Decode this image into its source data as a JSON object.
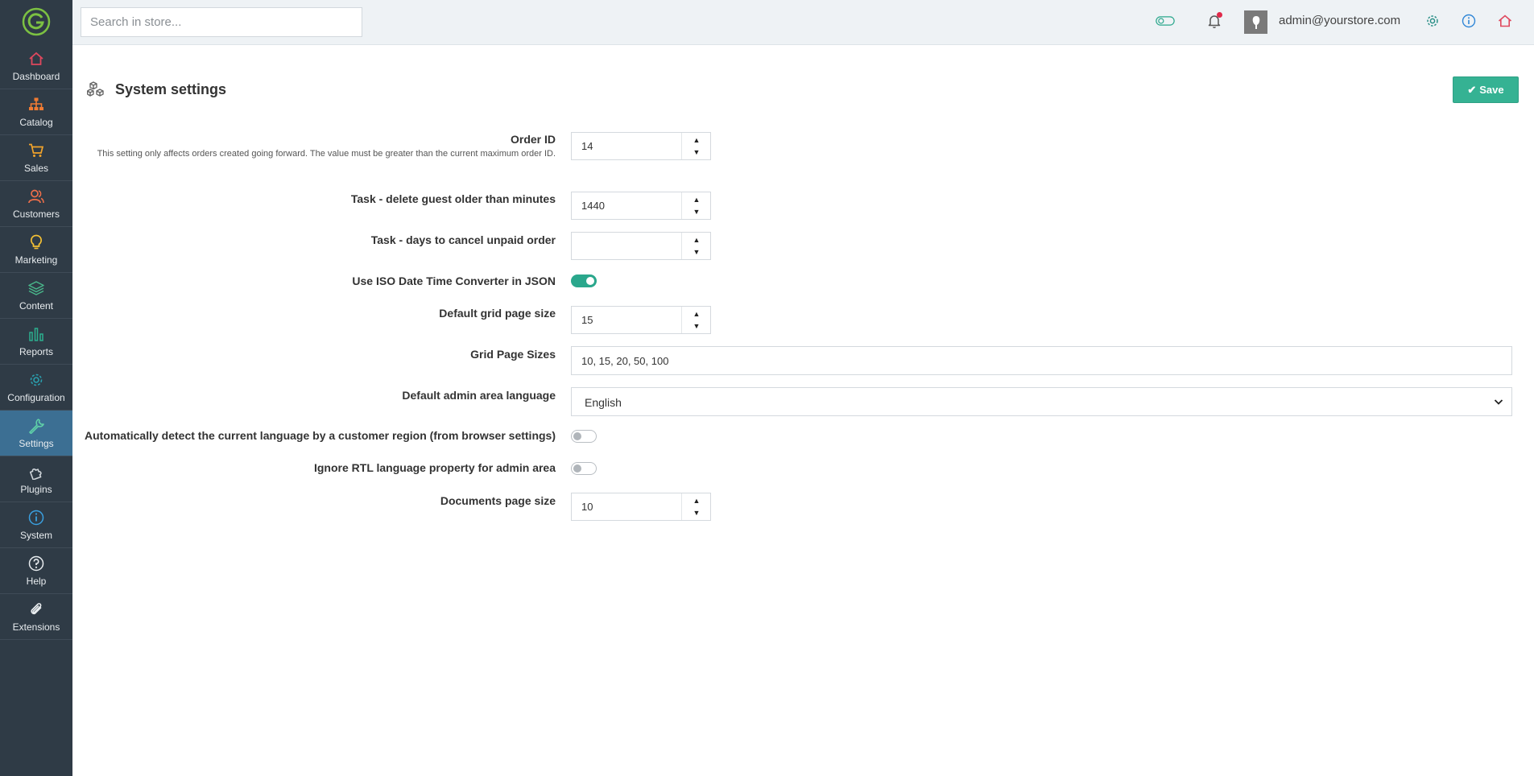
{
  "sidebar": {
    "items": [
      {
        "label": "Dashboard",
        "icon": "home-icon",
        "color": "#e0485e"
      },
      {
        "label": "Catalog",
        "icon": "sitemap-icon",
        "color": "#f07b33"
      },
      {
        "label": "Sales",
        "icon": "cart-icon",
        "color": "#f2a42b"
      },
      {
        "label": "Customers",
        "icon": "users-icon",
        "color": "#ef6f4a"
      },
      {
        "label": "Marketing",
        "icon": "lightbulb-icon",
        "color": "#f5c134"
      },
      {
        "label": "Content",
        "icon": "layers-icon",
        "color": "#49b58a"
      },
      {
        "label": "Reports",
        "icon": "bar-chart-icon",
        "color": "#2cae8e"
      },
      {
        "label": "Configuration",
        "icon": "gear-icon",
        "color": "#2a9fae"
      },
      {
        "label": "Settings",
        "icon": "wrench-icon",
        "color": "#5fd0a8"
      },
      {
        "label": "Plugins",
        "icon": "puzzle-icon",
        "color": "#cfd5da"
      },
      {
        "label": "System",
        "icon": "info-icon",
        "color": "#3aa0e0"
      },
      {
        "label": "Help",
        "icon": "help-icon",
        "color": "#e8ecef"
      },
      {
        "label": "Extensions",
        "icon": "paperclip-icon",
        "color": "#e8ecef"
      }
    ],
    "active": "Settings"
  },
  "header": {
    "search_placeholder": "Search in store...",
    "user": "admin@yourstore.com"
  },
  "page": {
    "title": "System settings",
    "save_label": "Save"
  },
  "form": {
    "order_id": {
      "label": "Order ID",
      "hint": "This setting only affects orders created going forward. The value must be greater than the current maximum order ID.",
      "value": "14"
    },
    "delete_guest": {
      "label": "Task - delete guest older than minutes",
      "value": "1440"
    },
    "cancel_unpaid": {
      "label": "Task - days to cancel unpaid order",
      "value": ""
    },
    "iso_date": {
      "label": "Use ISO Date Time Converter in JSON",
      "on": true
    },
    "grid_page_size": {
      "label": "Default grid page size",
      "value": "15"
    },
    "grid_page_sizes": {
      "label": "Grid Page Sizes",
      "value": "10, 15, 20, 50, 100"
    },
    "admin_language": {
      "label": "Default admin area language",
      "value": "English"
    },
    "auto_detect": {
      "label": "Automatically detect the current language by a customer region (from browser settings)",
      "on": false
    },
    "ignore_rtl": {
      "label": "Ignore RTL language property for admin area",
      "on": false
    },
    "documents_page_size": {
      "label": "Documents page size",
      "value": "10"
    }
  }
}
